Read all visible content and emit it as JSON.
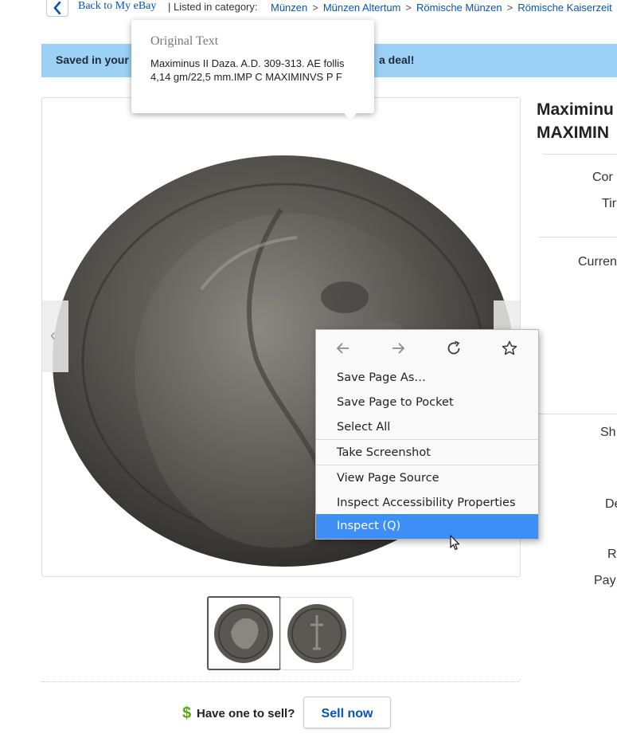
{
  "nav": {
    "back_label": "Back to My eBay",
    "listed_label": "| Listed in category:",
    "breadcrumbs": [
      "Münzen",
      "Münzen Altertum",
      "Römische Münzen",
      "Römische Kaiserzeit"
    ]
  },
  "banner": {
    "text_left": "Saved in your",
    "text_right": "a deal!"
  },
  "tooltip": {
    "title": "Original Text",
    "body": "Maximinus II Daza. A.D. 309-313. AE follis 4,14 gm/22,5 mm.IMP C MAXIMINVS P F"
  },
  "item": {
    "title_line1": "Maximinu",
    "title_line2": "MAXIMIN",
    "labels": [
      "Cor",
      "Tir",
      "Curren",
      "Sh",
      "De",
      "R",
      "Pay"
    ]
  },
  "gallery": {
    "prev_glyph": "‹"
  },
  "sell": {
    "dollar": "$",
    "question": "Have one to sell?",
    "button": "Sell now"
  },
  "context_menu": {
    "items": [
      "Save Page As…",
      "Save Page to Pocket",
      "Select All",
      "Take Screenshot",
      "View Page Source",
      "Inspect Accessibility Properties",
      "Inspect (Q)"
    ]
  },
  "colors": {
    "link": "#0654ba",
    "banner": "#9dd0f5",
    "menu_highlight": "#3d8ff5",
    "sell_dollar": "#5ba71b"
  }
}
